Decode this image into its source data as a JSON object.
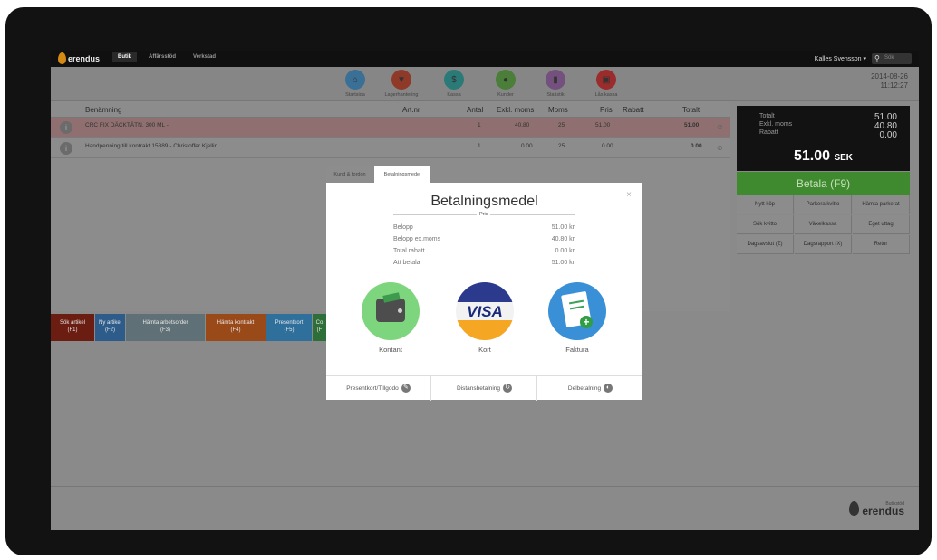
{
  "topbar": {
    "logo": "erendus",
    "tabs": [
      {
        "label": "Butik"
      },
      {
        "label": "Affärsstöd"
      },
      {
        "label": "Verkstad"
      }
    ],
    "user": "Kalles Svensson ▾",
    "search_placeholder": "Sök"
  },
  "toolbar": {
    "items": [
      {
        "label": "Startsida",
        "icon": "house-icon",
        "color": "#3a8bc9"
      },
      {
        "label": "Lagerhantering",
        "icon": "box-icon",
        "color": "#c1482c"
      },
      {
        "label": "Kassa",
        "icon": "register-icon",
        "color": "#2a9c9a"
      },
      {
        "label": "Kunder",
        "icon": "person-icon",
        "color": "#4eaa3a"
      },
      {
        "label": "Statistik",
        "icon": "bars-icon",
        "color": "#9b59b6"
      },
      {
        "label": "Lås kassa",
        "icon": "lock-icon",
        "color": "#d23030"
      }
    ],
    "date": "2014-08-26",
    "time": "11:12:27"
  },
  "table": {
    "columns": [
      "Benämning",
      "Art.nr",
      "Antal",
      "Exkl. moms",
      "Moms",
      "Pris",
      "Rabatt",
      "Totalt"
    ],
    "rows": [
      {
        "name": "CRC FIX DÄCKTÄTN. 300 ML -",
        "artnr": "",
        "antal": "1",
        "exkl": "40.80",
        "moms": "25",
        "pris": "51.00",
        "rabatt": "",
        "totalt": "51.00"
      },
      {
        "name": "Handpenning till kontrakt 15889 - Christoffer Kjellin",
        "artnr": "",
        "antal": "1",
        "exkl": "0.00",
        "moms": "25",
        "pris": "0.00",
        "rabatt": "",
        "totalt": "0.00"
      }
    ]
  },
  "totals": {
    "totalt_label": "Totalt",
    "totalt": "51.00",
    "exkl_label": "Exkl. moms",
    "exkl": "40.80",
    "rabatt_label": "Rabatt",
    "rabatt": "0.00",
    "big": "51.00",
    "currency": "SEK"
  },
  "pay_button": "Betala (F9)",
  "actions": [
    "Nytt köp",
    "Parkera kvitto",
    "Hämta parkerat",
    "Sök kvitto",
    "Växelkassa",
    "Eget uttag",
    "Dagsavslut (Z)",
    "Dagsrapport (X)",
    "Retur"
  ],
  "fkeys": [
    {
      "label": "Sök artikel",
      "key": "(F1)",
      "color": "#6b1d12"
    },
    {
      "label": "Ny artikel",
      "key": "(F2)",
      "color": "#2d5c8a"
    },
    {
      "label": "Hämta arbetsorder",
      "key": "(F3)",
      "color": "#5f7176"
    },
    {
      "label": "Hämta kontrakt",
      "key": "(F4)",
      "color": "#b1551a"
    },
    {
      "label": "Presentkort",
      "key": "(F5)",
      "color": "#2e7fb3"
    },
    {
      "label": "Co",
      "key": "(F",
      "color": "#2e6e38"
    }
  ],
  "footer": {
    "sub": "Butikstöd",
    "logo": "erendus"
  },
  "modal": {
    "tabs": [
      "Kund & fordon",
      "Betalningsmedel"
    ],
    "title": "Betalningsmedel",
    "pris": "Pris",
    "summary": [
      {
        "label": "Belopp",
        "value": "51.00 kr"
      },
      {
        "label": "Belopp ex.moms",
        "value": "40.80 kr"
      },
      {
        "label": "Total rabatt",
        "value": "0.00 kr"
      },
      {
        "label": "Att betala",
        "value": "51.00 kr"
      }
    ],
    "methods": [
      {
        "label": "Kontant",
        "icon": "wallet-icon"
      },
      {
        "label": "Kort",
        "icon": "visa-card-icon",
        "brand": "VISA"
      },
      {
        "label": "Faktura",
        "icon": "invoice-icon"
      }
    ],
    "footer": [
      {
        "label": "Presentkort/Tillgodo"
      },
      {
        "label": "Distansbetalning"
      },
      {
        "label": "Delbetalning"
      }
    ]
  }
}
